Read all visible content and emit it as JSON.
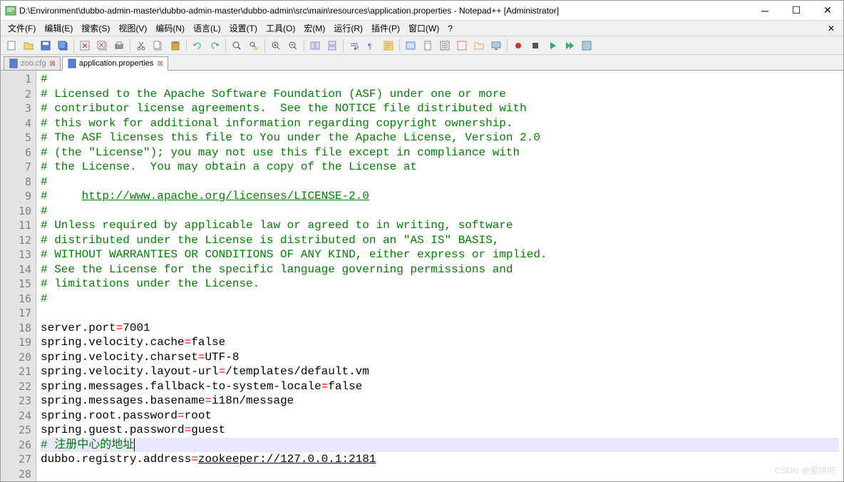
{
  "window": {
    "title": "D:\\Environment\\dubbo-admin-master\\dubbo-admin-master\\dubbo-admin\\src\\main\\resources\\application.properties - Notepad++ [Administrator]"
  },
  "menu": {
    "file": "文件(F)",
    "edit": "编辑(E)",
    "search": "搜索(S)",
    "view": "视图(V)",
    "encoding": "编码(N)",
    "language": "语言(L)",
    "settings": "设置(T)",
    "tools": "工具(O)",
    "macro": "宏(M)",
    "run": "运行(R)",
    "plugins": "插件(P)",
    "window": "窗口(W)",
    "help": "?"
  },
  "tabs": [
    {
      "label": "zoo.cfg",
      "active": false
    },
    {
      "label": "application.properties",
      "active": true
    }
  ],
  "lines": [
    {
      "n": "1",
      "type": "comment",
      "text": "#"
    },
    {
      "n": "2",
      "type": "comment",
      "text": "# Licensed to the Apache Software Foundation (ASF) under one or more"
    },
    {
      "n": "3",
      "type": "comment",
      "text": "# contributor license agreements.  See the NOTICE file distributed with"
    },
    {
      "n": "4",
      "type": "comment",
      "text": "# this work for additional information regarding copyright ownership."
    },
    {
      "n": "5",
      "type": "comment",
      "text": "# The ASF licenses this file to You under the Apache License, Version 2.0"
    },
    {
      "n": "6",
      "type": "comment",
      "text": "# (the \"License\"); you may not use this file except in compliance with"
    },
    {
      "n": "7",
      "type": "comment",
      "text": "# the License.  You may obtain a copy of the License at"
    },
    {
      "n": "8",
      "type": "comment",
      "text": "#"
    },
    {
      "n": "9",
      "type": "comment_link",
      "prefix": "#     ",
      "link": "http://www.apache.org/licenses/LICENSE-2.0"
    },
    {
      "n": "10",
      "type": "comment",
      "text": "#"
    },
    {
      "n": "11",
      "type": "comment",
      "text": "# Unless required by applicable law or agreed to in writing, software"
    },
    {
      "n": "12",
      "type": "comment",
      "text": "# distributed under the License is distributed on an \"AS IS\" BASIS,"
    },
    {
      "n": "13",
      "type": "comment",
      "text": "# WITHOUT WARRANTIES OR CONDITIONS OF ANY KIND, either express or implied."
    },
    {
      "n": "14",
      "type": "comment",
      "text": "# See the License for the specific language governing permissions and"
    },
    {
      "n": "15",
      "type": "comment",
      "text": "# limitations under the License."
    },
    {
      "n": "16",
      "type": "comment",
      "text": "#"
    },
    {
      "n": "17",
      "type": "blank",
      "text": ""
    },
    {
      "n": "18",
      "type": "prop",
      "key": "server.port",
      "val": "7001"
    },
    {
      "n": "19",
      "type": "prop",
      "key": "spring.velocity.cache",
      "val": "false"
    },
    {
      "n": "20",
      "type": "prop",
      "key": "spring.velocity.charset",
      "val": "UTF-8"
    },
    {
      "n": "21",
      "type": "prop",
      "key": "spring.velocity.layout-url",
      "val": "/templates/default.vm"
    },
    {
      "n": "22",
      "type": "prop",
      "key": "spring.messages.fallback-to-system-locale",
      "val": "false"
    },
    {
      "n": "23",
      "type": "prop",
      "key": "spring.messages.basename",
      "val": "i18n/message"
    },
    {
      "n": "24",
      "type": "prop",
      "key": "spring.root.password",
      "val": "root"
    },
    {
      "n": "25",
      "type": "prop",
      "key": "spring.guest.password",
      "val": "guest"
    },
    {
      "n": "26",
      "type": "comment_hl",
      "text": "# 注册中心的地址"
    },
    {
      "n": "27",
      "type": "prop_link",
      "key": "dubbo.registry.address",
      "val": "zookeeper://127.0.0.1:2181"
    },
    {
      "n": "28",
      "type": "blank",
      "text": ""
    }
  ],
  "watermark": "CSDN @蛋饼吧"
}
